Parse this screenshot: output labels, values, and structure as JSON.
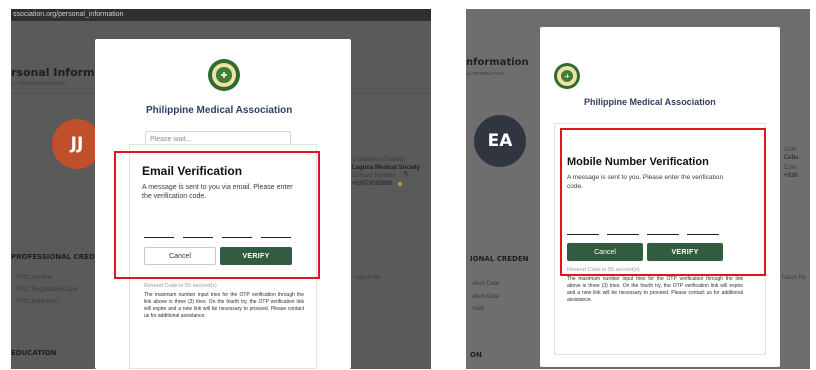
{
  "colors": {
    "accent_green": "#325c3f",
    "title_blue": "#2f3e66",
    "highlight_red": "#e0141e",
    "avatar_left": "#c0502b",
    "avatar_right": "#2f3640"
  },
  "left": {
    "url_text": "ssociation.org/personal_information",
    "header_title": "rsonal Informatio",
    "breadcrumb": "s > Personal Information",
    "avatar_initials": "JJ",
    "side_info": {
      "label": "Component Society",
      "society": "Laguna Medical Society",
      "number_label": "Contact Number",
      "number": "+63978085899"
    },
    "section_professional": "PROFESSIONAL CRED",
    "prof_rows": [
      "PRC Number",
      "PRC Registration Date",
      "PRC Expiration"
    ],
    "right_field": "ration No",
    "section_education": "EDUCATION",
    "modal": {
      "org_name": "Philippine Medical Association",
      "wait_placeholder": "Please wait...",
      "title": "Email Verification",
      "message": "A message is sent to you via email. Please enter the verification code.",
      "cancel_label": "Cancel",
      "verify_label": "VERIFY",
      "resend": "Resend Code in 55 second(s)",
      "notice": "The maximum number input tries for the OTP verification through the link above is three (3) tries. On the fourth try, the OTP verification link will expire and a new link will be necessary to proceed. Please contact us for additional assistance."
    }
  },
  "right": {
    "header_title": "nformation",
    "breadcrumb": "AL INFORMATION",
    "avatar_initials": "EA",
    "side_label": "Com",
    "side_city": "Cebu",
    "side_label2": "Cont",
    "side_number": "+639",
    "section_professional": "IONAL CREDEN",
    "prof_rows": [
      "ation Date",
      "ation Date",
      "ntab"
    ],
    "right_field": "ration No",
    "section_bottom": "ON",
    "modal": {
      "org_name": "Philippine Medical Association",
      "title": "Mobile Number Verification",
      "message": "A message is sent to you. Please enter the verification code.",
      "cancel_label": "Cancel",
      "verify_label": "VERIFY",
      "resend": "Resend Code in 55 second(s)",
      "notice": "The maximum number input tries for the OTP verification through the link above is three (3) tries. On the fourth try, the OTP verification link will expire and a new link will be necessary to proceed. Please contact us for additional assistance."
    }
  }
}
